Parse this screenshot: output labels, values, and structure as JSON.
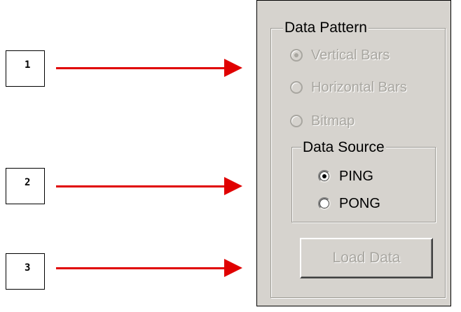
{
  "callouts": [
    {
      "number": "1"
    },
    {
      "number": "2"
    },
    {
      "number": "3"
    }
  ],
  "colors": {
    "arrow": "#e00000",
    "panel_bg": "#d6d3ce",
    "disabled_text": "#a8a6a0"
  },
  "data_pattern": {
    "legend": "Data Pattern",
    "options": [
      {
        "label": "Vertical Bars",
        "selected": true,
        "enabled": false
      },
      {
        "label": "Horizontal Bars",
        "selected": false,
        "enabled": false
      },
      {
        "label": "Bitmap",
        "selected": false,
        "enabled": false
      }
    ]
  },
  "data_source": {
    "legend": "Data Source",
    "options": [
      {
        "label": "PING",
        "selected": true,
        "enabled": true
      },
      {
        "label": "PONG",
        "selected": false,
        "enabled": true
      }
    ]
  },
  "load_button": {
    "label": "Load Data",
    "enabled": false
  }
}
